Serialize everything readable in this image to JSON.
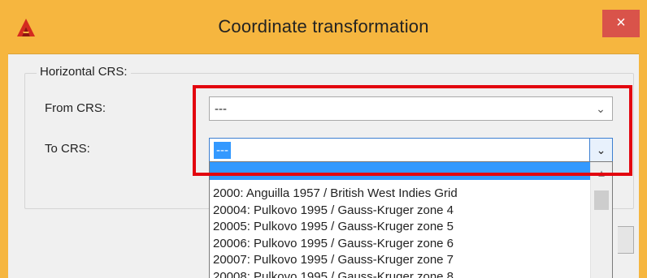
{
  "window": {
    "title": "Coordinate transformation",
    "close_glyph": "×",
    "accent_color": "#f6b63f",
    "close_color": "#d9534a"
  },
  "app_icon": {
    "name": "autocad-logo-icon"
  },
  "group": {
    "label": "Horizontal CRS:"
  },
  "from_crs": {
    "label": "From CRS:",
    "value": "---",
    "arrow_glyph": "⌄"
  },
  "to_crs": {
    "label": "To CRS:",
    "value": "---",
    "arrow_glyph": "⌄"
  },
  "dropdown": {
    "items": [
      "2000: Anguilla 1957 / British West Indies Grid",
      "20004: Pulkovo 1995 / Gauss-Kruger zone 4",
      "20005: Pulkovo 1995 / Gauss-Kruger zone 5",
      "20006: Pulkovo 1995 / Gauss-Kruger zone 6",
      "20007: Pulkovo 1995 / Gauss-Kruger zone 7",
      "20008: Pulkovo 1995 / Gauss-Kruger zone 8"
    ],
    "scroll_up_glyph": "▲"
  },
  "annotation": {
    "highlight_color": "#e3060f"
  }
}
